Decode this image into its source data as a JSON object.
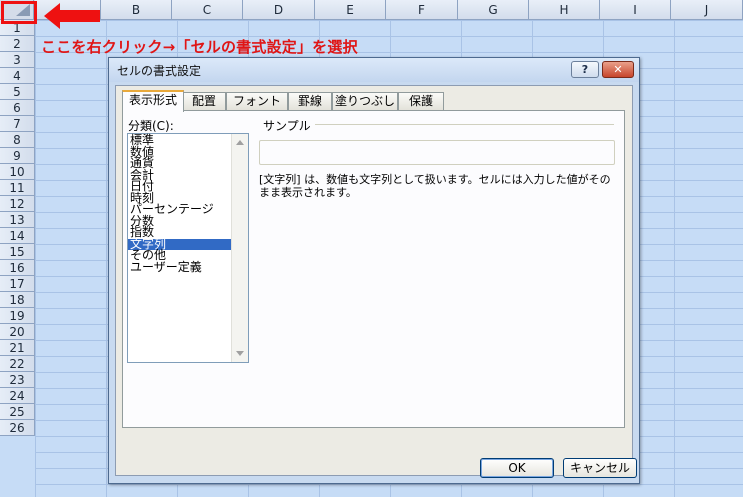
{
  "sheet": {
    "columns": [
      "B",
      "C",
      "D",
      "E",
      "F",
      "G",
      "H",
      "I",
      "J"
    ],
    "rows": [
      "1",
      "2",
      "3",
      "4",
      "5",
      "6",
      "7",
      "8",
      "9",
      "10",
      "11",
      "12",
      "13",
      "14",
      "15",
      "16",
      "17",
      "18",
      "19",
      "20",
      "21",
      "22",
      "23",
      "24",
      "25",
      "26"
    ]
  },
  "annotation": "ここを右クリック→「セルの書式設定」を選択",
  "annotation_color": "#e01515",
  "dialog": {
    "title": "セルの書式設定",
    "help_label": "?",
    "close_label": "✕",
    "tabs": [
      "表示形式",
      "配置",
      "フォント",
      "罫線",
      "塗りつぶし",
      "保護"
    ],
    "active_tab": 0,
    "category_label": "分類(C):",
    "categories": [
      "標準",
      "数値",
      "通貨",
      "会計",
      "日付",
      "時刻",
      "パーセンテージ",
      "分数",
      "指数",
      "文字列",
      "その他",
      "ユーザー定義"
    ],
    "selected_category": 9,
    "sample_label": "サンプル",
    "description": "[文字列] は、数値も文字列として扱います。セルには入力した値がそのまま表示されます。",
    "ok_label": "OK",
    "cancel_label": "キャンセル"
  }
}
